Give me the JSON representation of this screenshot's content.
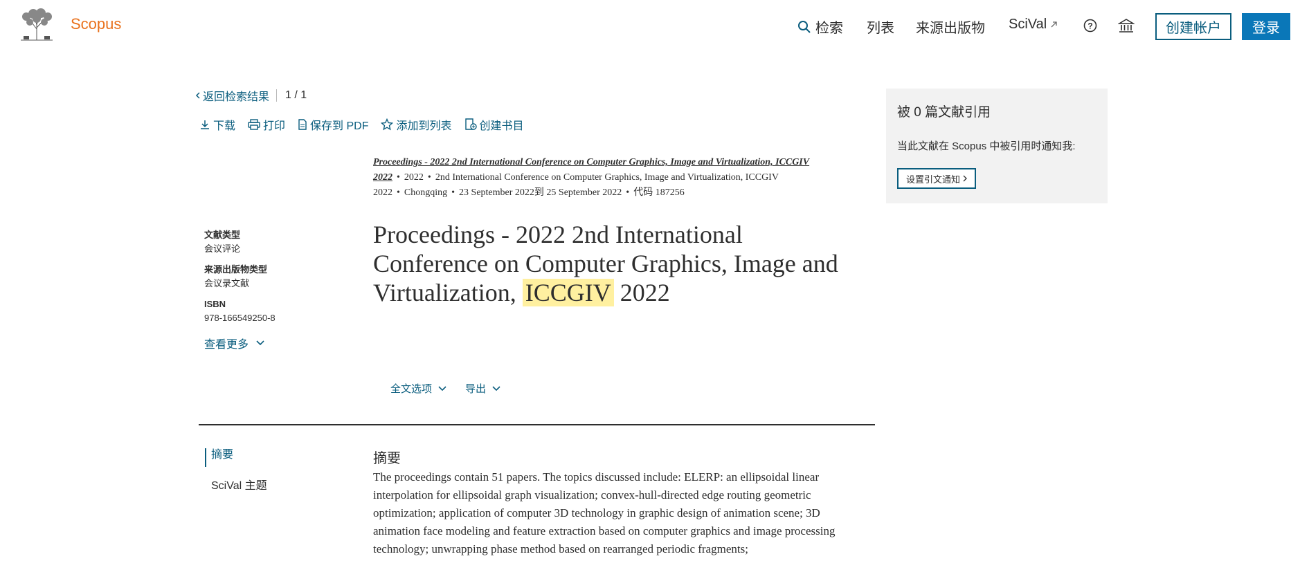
{
  "header": {
    "brand": "Scopus",
    "nav": {
      "search": "检索",
      "lists": "列表",
      "sources": "来源出版物",
      "scival": "SciVal"
    },
    "create_account": "创建帐户",
    "login": "登录",
    "colors": {
      "brand": "#e9711c",
      "primary": "#0a77b8",
      "link": "#0a5d7e"
    }
  },
  "breadcrumb": {
    "back": "返回检索结果",
    "pager": "1 / 1"
  },
  "toolbar": {
    "download": "下载",
    "print": "打印",
    "save_pdf": "保存到 PDF",
    "add_to_list": "添加到列表",
    "create_bibliography": "创建书目"
  },
  "source": {
    "title": "Proceedings - 2022 2nd International Conference on Computer Graphics, Image and Virtualization, ICCGIV 2022",
    "year": "2022",
    "conference": "2nd International Conference on Computer Graphics, Image and Virtualization, ICCGIV 2022",
    "location": "Chongqing",
    "dates": "23 September 2022到 25 September 2022",
    "code": "代码 187256"
  },
  "meta": {
    "doc_type_label": "文献类型",
    "doc_type_value": "会议评论",
    "source_type_label": "来源出版物类型",
    "source_type_value": "会议录文献",
    "isbn_label": "ISBN",
    "isbn_value": "978-166549250-8",
    "see_more": "查看更多"
  },
  "title": {
    "before": "Proceedings - 2022 2nd International Conference on Computer Graphics, Image and Virtualization, ",
    "highlight": "ICCGIV",
    "after": " 2022"
  },
  "options": {
    "full_text": "全文选项",
    "export": "导出"
  },
  "subnav": {
    "abstract": "摘要",
    "scival_topics": "SciVal 主题"
  },
  "abstract": {
    "heading": "摘要",
    "text": "The proceedings contain 51 papers. The topics discussed include: ELERP: an ellipsoidal linear interpolation for ellipsoidal graph visualization; convex-hull-directed edge routing geometric optimization; application of computer 3D technology in graphic design of animation scene; 3D animation face modeling and feature extraction based on computer graphics and image processing technology; unwrapping phase method based on rearranged periodic fragments;"
  },
  "citations": {
    "title": "被 0 篇文献引用",
    "desc": "当此文献在 Scopus 中被引用时通知我:",
    "button": "设置引文通知"
  }
}
